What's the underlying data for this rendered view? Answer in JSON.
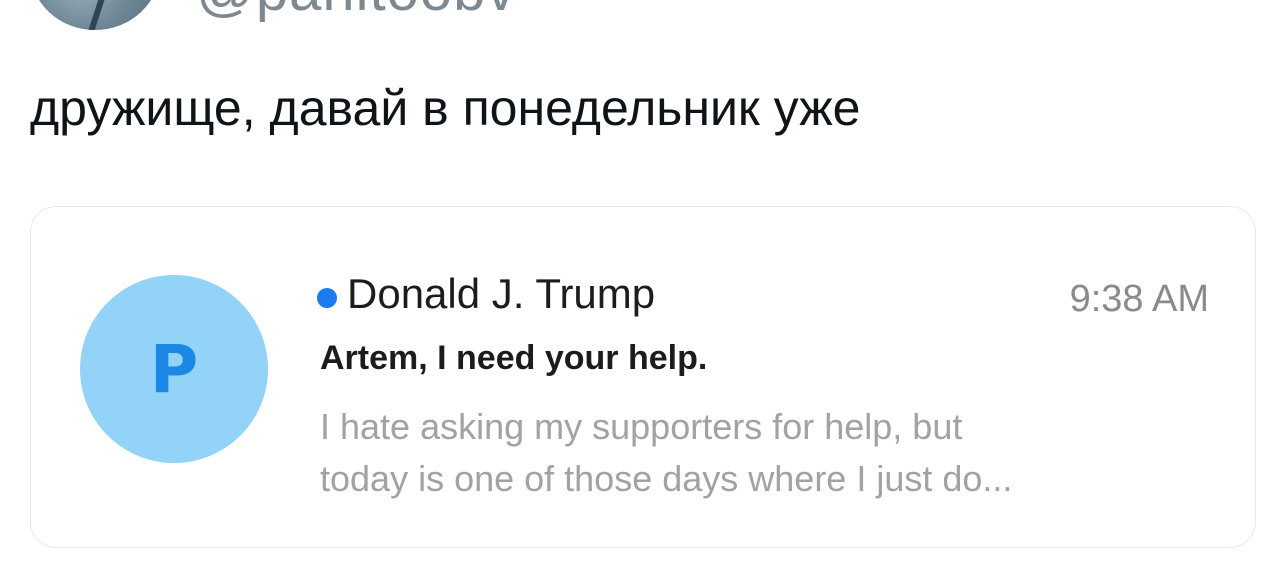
{
  "tweet": {
    "handle": "@panitoobv",
    "text": "дружище, давай в понедельник уже"
  },
  "email_card": {
    "avatar_letter": "P",
    "sender": "Donald J. Trump",
    "time": "9:38 AM",
    "subject": "Artem, I need your help.",
    "preview_lines": [
      "I hate asking my supporters for help, but",
      "today is one of those days where I just do..."
    ],
    "unread": true,
    "colors": {
      "unread_dot": "#1a7cf0",
      "avatar_bg": "#93d3f8",
      "avatar_letter": "#1b88e6"
    }
  }
}
